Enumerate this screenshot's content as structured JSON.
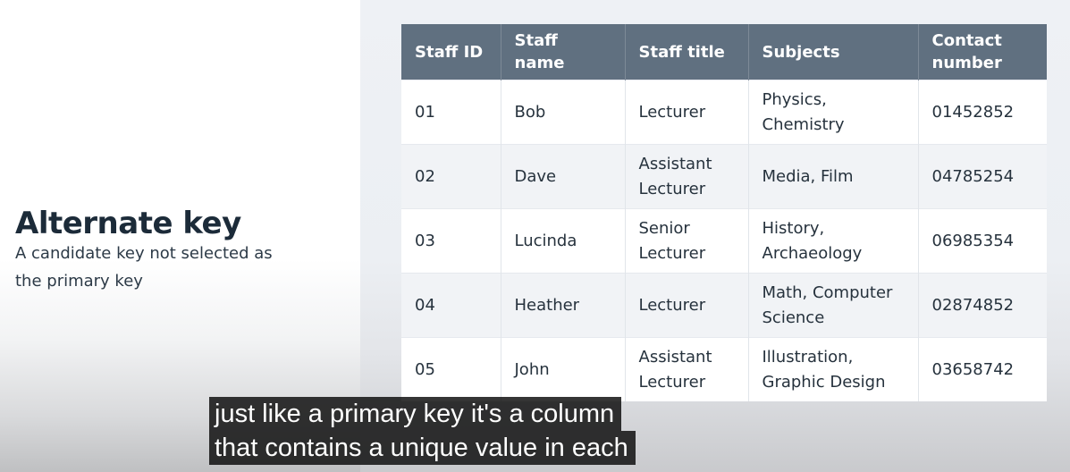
{
  "slide": {
    "heading": "Alternate key",
    "description": "A candidate key not selected as the primary key"
  },
  "table": {
    "headers": [
      "Staff ID",
      "Staff name",
      "Staff title",
      "Subjects",
      "Contact number"
    ],
    "rows": [
      [
        "01",
        "Bob",
        "Lecturer",
        "Physics, Chemistry",
        "01452852"
      ],
      [
        "02",
        "Dave",
        "Assistant Lecturer",
        "Media, Film",
        "04785254"
      ],
      [
        "03",
        "Lucinda",
        "Senior Lecturer",
        "History, Archaeology",
        "06985354"
      ],
      [
        "04",
        "Heather",
        "Lecturer",
        "Math, Computer Science",
        "02874852"
      ],
      [
        "05",
        "John",
        "Assistant Lecturer",
        "Illustration, Graphic Design",
        "03658742"
      ]
    ]
  },
  "caption": {
    "lines": [
      "just like a primary key it's a column",
      "that contains a unique value in each"
    ]
  },
  "colors": {
    "header_bg": "#607080",
    "heading_text": "#1c2b39",
    "caption_bg": "#080808"
  }
}
